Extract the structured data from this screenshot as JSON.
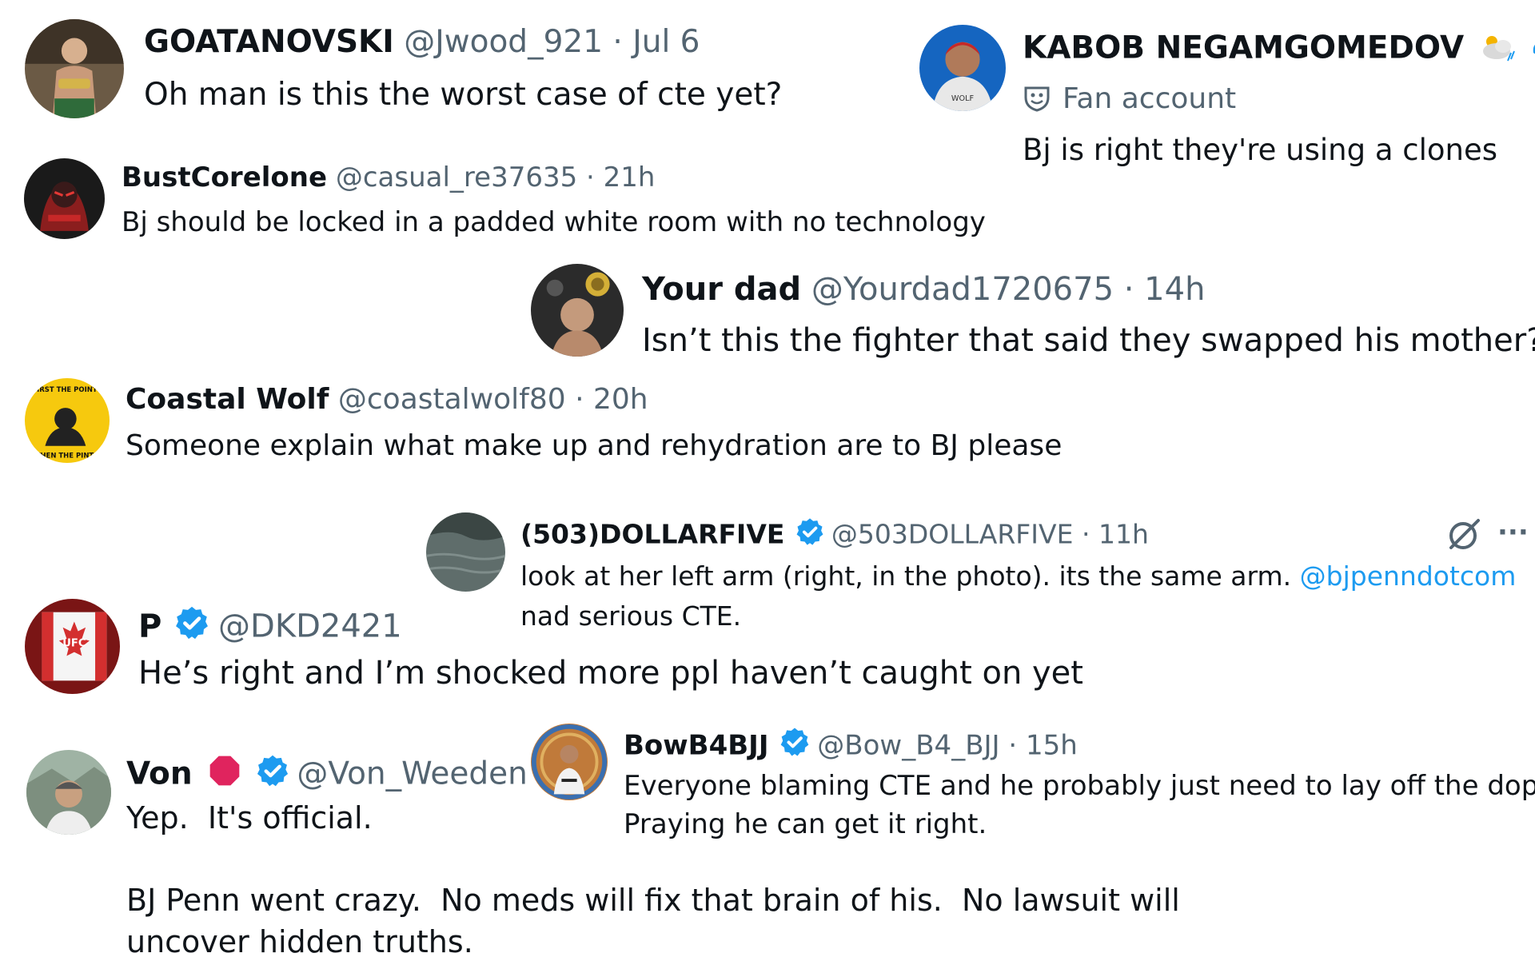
{
  "posts": [
    {
      "name": "GOATANOVSKI",
      "handle": "@Jwood_921",
      "sep": "·",
      "time": "Jul 6",
      "text": "Oh man is this the worst case of cte yet?"
    },
    {
      "name": "KABOB NEGAMGOMEDOV",
      "fan_label": "Fan account",
      "text": "Bj is right they're using a clones"
    },
    {
      "name": "BustCorelone",
      "handle": "@casual_re37635",
      "sep": "·",
      "time": "21h",
      "text": "Bj should be locked in a padded white room with no technology"
    },
    {
      "name": "Your dad",
      "handle": "@Yourdad1720675",
      "sep": "·",
      "time": "14h",
      "text": "Isn’t this the fighter that said they swapped his mother?"
    },
    {
      "name": "Coastal Wolf",
      "handle": "@coastalwolf80",
      "sep": "·",
      "time": "20h",
      "text": "Someone explain what make up and rehydration are to BJ please",
      "avatar_text_top": "FIRST THE POINTS",
      "avatar_text_bottom": "THEN THE PINTS"
    },
    {
      "name": "(503)DOLLARFIVE",
      "handle": "@503DOLLARFIVE",
      "sep": "·",
      "time": "11h",
      "text_line1": "look at her left arm (right, in the photo). its the same arm.",
      "mention": "@bjpenndotcom",
      "text_line2": "nad serious CTE.",
      "more": "···"
    },
    {
      "name": "P",
      "handle": "@DKD2421",
      "text": "He’s right and I’m shocked more ppl haven’t caught on yet",
      "avatar_text": "UFC"
    },
    {
      "name": "Von",
      "handle": "@Von_Weeden",
      "text_line1": "Yep.  It's official.",
      "text_line2": "BJ Penn went crazy.  No meds will fix that brain of his.  No lawsuit will",
      "text_line3": "uncover hidden truths."
    },
    {
      "name": "BowB4BJJ",
      "handle": "@Bow_B4_BJJ",
      "sep": "·",
      "time": "15h",
      "text_line1": "Everyone blaming CTE and he probably just need to lay off the dope.",
      "text_line2": "Praying he can get it right."
    }
  ],
  "colors": {
    "text": "#0f1419",
    "muted": "#536471",
    "link": "#1d9bf0",
    "verified": "#1d9bf0",
    "red_badge": "#e0245e"
  },
  "icons": [
    "verified-badge-icon",
    "red-badge-icon",
    "fan-account-icon",
    "emoji-icon",
    "grok-icon",
    "more-icon"
  ]
}
